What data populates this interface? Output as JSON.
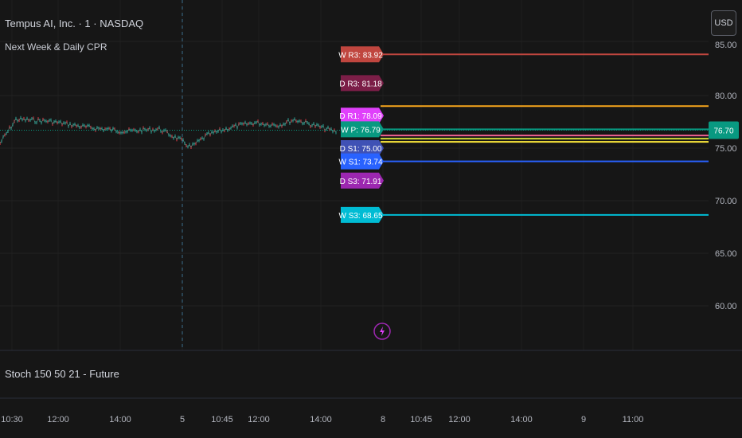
{
  "header": {
    "symbol_line": "Tempus AI, Inc. · 1 · NASDAQ",
    "indicator_name": "Next Week & Daily CPR"
  },
  "currency_button": "USD",
  "price_axis": {
    "ticks": [
      "80.00",
      "75.00",
      "70.00",
      "65.00",
      "60.00"
    ],
    "partial_top_tick": "85.00",
    "current_price": "76.70",
    "current_price_color": "#089981"
  },
  "time_axis": {
    "ticks": [
      "10:30",
      "12:00",
      "14:00",
      "5",
      "10:45",
      "12:00",
      "14:00",
      "8",
      "10:45",
      "12:00",
      "14:00",
      "9",
      "11:00"
    ]
  },
  "levels": [
    {
      "label": "W R3: 83.92",
      "price": 83.92,
      "color": "#c0463f",
      "line": true
    },
    {
      "label": "D R3: 81.18",
      "price": 81.18,
      "color": "#7b1e47",
      "line": false
    },
    {
      "label": "D R1: 78.09",
      "price": 78.09,
      "color": "#e040fb",
      "line": false
    },
    {
      "label": "",
      "price": 79.0,
      "color": "#f7a51c",
      "line": true
    },
    {
      "label": "W P: 76.79",
      "price": 76.79,
      "color": "#089981",
      "line": true
    },
    {
      "label": "",
      "price": 76.2,
      "color": "#f06292",
      "line": true
    },
    {
      "label": "",
      "price": 75.9,
      "color": "#cddc39",
      "line": true
    },
    {
      "label": "",
      "price": 75.6,
      "color": "#ffeb3b",
      "line": true
    },
    {
      "label": "D S1: 75.00",
      "price": 75.0,
      "color": "#3f51b5",
      "line": false
    },
    {
      "label": "W S1: 73.74",
      "price": 73.74,
      "color": "#2962ff",
      "line": true
    },
    {
      "label": "D S3: 71.91",
      "price": 71.91,
      "color": "#9c27b0",
      "line": false
    },
    {
      "label": "W S3: 68.65",
      "price": 68.65,
      "color": "#00bcd4",
      "line": true
    }
  ],
  "lower_pane": {
    "title": "Stoch 150 50 21 - Future"
  },
  "icons": {
    "replay": "lightning-icon"
  }
}
